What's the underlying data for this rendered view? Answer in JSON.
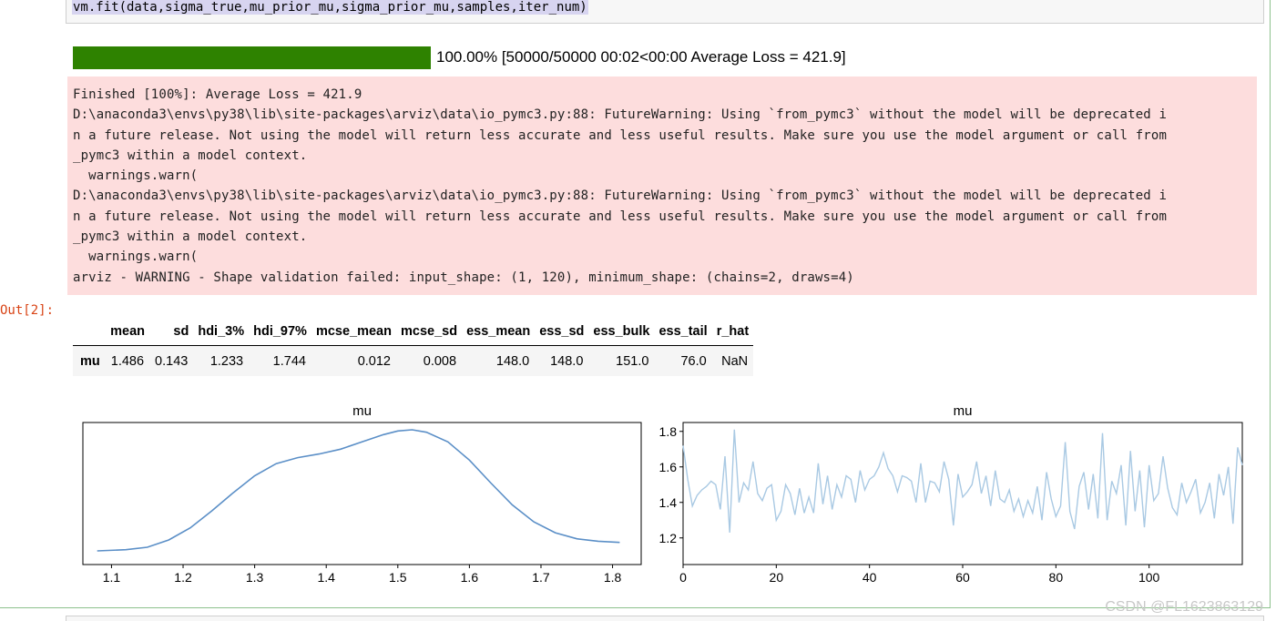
{
  "code_cell": {
    "source": "vm.fit(data,sigma_true,mu_prior_mu,sigma_prior_mu,samples,iter_num)"
  },
  "progress": {
    "fraction": 1.0,
    "text": "100.00% [50000/50000 00:02<00:00 Average Loss = 421.9]",
    "color": "#2e8200"
  },
  "stderr": {
    "lines": [
      "Finished [100%]: Average Loss = 421.9",
      "D:\\anaconda3\\envs\\py38\\lib\\site-packages\\arviz\\data\\io_pymc3.py:88: FutureWarning: Using `from_pymc3` without the model will be deprecated i",
      "n a future release. Not using the model will return less accurate and less useful results. Make sure you use the model argument or call from",
      "_pymc3 within a model context.",
      "  warnings.warn(",
      "D:\\anaconda3\\envs\\py38\\lib\\site-packages\\arviz\\data\\io_pymc3.py:88: FutureWarning: Using `from_pymc3` without the model will be deprecated i",
      "n a future release. Not using the model will return less accurate and less useful results. Make sure you use the model argument or call from",
      "_pymc3 within a model context.",
      "  warnings.warn(",
      "arviz - WARNING - Shape validation failed: input_shape: (1, 120), minimum_shape: (chains=2, draws=4)"
    ],
    "background": "#fddddd"
  },
  "output": {
    "prompt": "Out[2]:",
    "table": {
      "columns": [
        "",
        "mean",
        "sd",
        "hdi_3%",
        "hdi_97%",
        "mcse_mean",
        "mcse_sd",
        "ess_mean",
        "ess_sd",
        "ess_bulk",
        "ess_tail",
        "r_hat"
      ],
      "rows": [
        [
          "mu",
          "1.486",
          "0.143",
          "1.233",
          "1.744",
          "0.012",
          "0.008",
          "148.0",
          "148.0",
          "151.0",
          "76.0",
          "NaN"
        ]
      ]
    }
  },
  "chart_data": [
    {
      "type": "line",
      "title": "mu",
      "xlabel": "",
      "ylabel": "",
      "xlim": [
        1.06,
        1.84
      ],
      "x_ticks": [
        "1.1",
        "1.2",
        "1.3",
        "1.4",
        "1.5",
        "1.6",
        "1.7",
        "1.8"
      ],
      "y_ticks": [],
      "grid": false,
      "color": "#5b8fc7",
      "series": [
        {
          "x": [
            1.08,
            1.12,
            1.15,
            1.18,
            1.21,
            1.24,
            1.27,
            1.3,
            1.33,
            1.36,
            1.39,
            1.42,
            1.45,
            1.48,
            1.5,
            1.52,
            1.54,
            1.57,
            1.6,
            1.63,
            1.66,
            1.69,
            1.72,
            1.75,
            1.78,
            1.81
          ],
          "y": [
            0.0,
            0.01,
            0.03,
            0.09,
            0.19,
            0.33,
            0.48,
            0.62,
            0.72,
            0.77,
            0.8,
            0.84,
            0.9,
            0.96,
            0.99,
            1.0,
            0.98,
            0.9,
            0.75,
            0.56,
            0.38,
            0.24,
            0.15,
            0.1,
            0.08,
            0.07
          ]
        }
      ]
    },
    {
      "type": "line",
      "title": "mu",
      "xlabel": "",
      "ylabel": "",
      "xlim": [
        0,
        120
      ],
      "ylim": [
        1.05,
        1.85
      ],
      "x_ticks": [
        "0",
        "20",
        "40",
        "60",
        "80",
        "100"
      ],
      "y_ticks": [
        "1.2",
        "1.4",
        "1.6",
        "1.8"
      ],
      "grid": false,
      "color": "#a9c9e3",
      "series": [
        {
          "y": [
            1.72,
            1.53,
            1.38,
            1.44,
            1.47,
            1.49,
            1.52,
            1.5,
            1.36,
            1.66,
            1.23,
            1.81,
            1.4,
            1.51,
            1.47,
            1.63,
            1.45,
            1.41,
            1.48,
            1.5,
            1.3,
            1.35,
            1.5,
            1.45,
            1.33,
            1.48,
            1.34,
            1.43,
            1.34,
            1.62,
            1.39,
            1.55,
            1.36,
            1.5,
            1.43,
            1.55,
            1.53,
            1.4,
            1.58,
            1.47,
            1.53,
            1.55,
            1.6,
            1.68,
            1.59,
            1.55,
            1.46,
            1.55,
            1.54,
            1.52,
            1.4,
            1.62,
            1.4,
            1.52,
            1.51,
            1.46,
            1.63,
            1.53,
            1.27,
            1.56,
            1.43,
            1.46,
            1.5,
            1.63,
            1.45,
            1.55,
            1.38,
            1.58,
            1.42,
            1.4,
            1.47,
            1.35,
            1.42,
            1.32,
            1.41,
            1.34,
            1.49,
            1.3,
            1.57,
            1.42,
            1.32,
            1.38,
            1.74,
            1.35,
            1.25,
            1.49,
            1.57,
            1.36,
            1.56,
            1.31,
            1.79,
            1.3,
            1.52,
            1.45,
            1.61,
            1.27,
            1.69,
            1.35,
            1.58,
            1.26,
            1.61,
            1.41,
            1.45,
            1.66,
            1.48,
            1.37,
            1.33,
            1.51,
            1.4,
            1.46,
            1.53,
            1.34,
            1.4,
            1.51,
            1.31,
            1.56,
            1.44,
            1.6,
            1.28,
            1.71,
            1.61
          ]
        }
      ]
    }
  ],
  "watermark": "CSDN @FL1623863129"
}
